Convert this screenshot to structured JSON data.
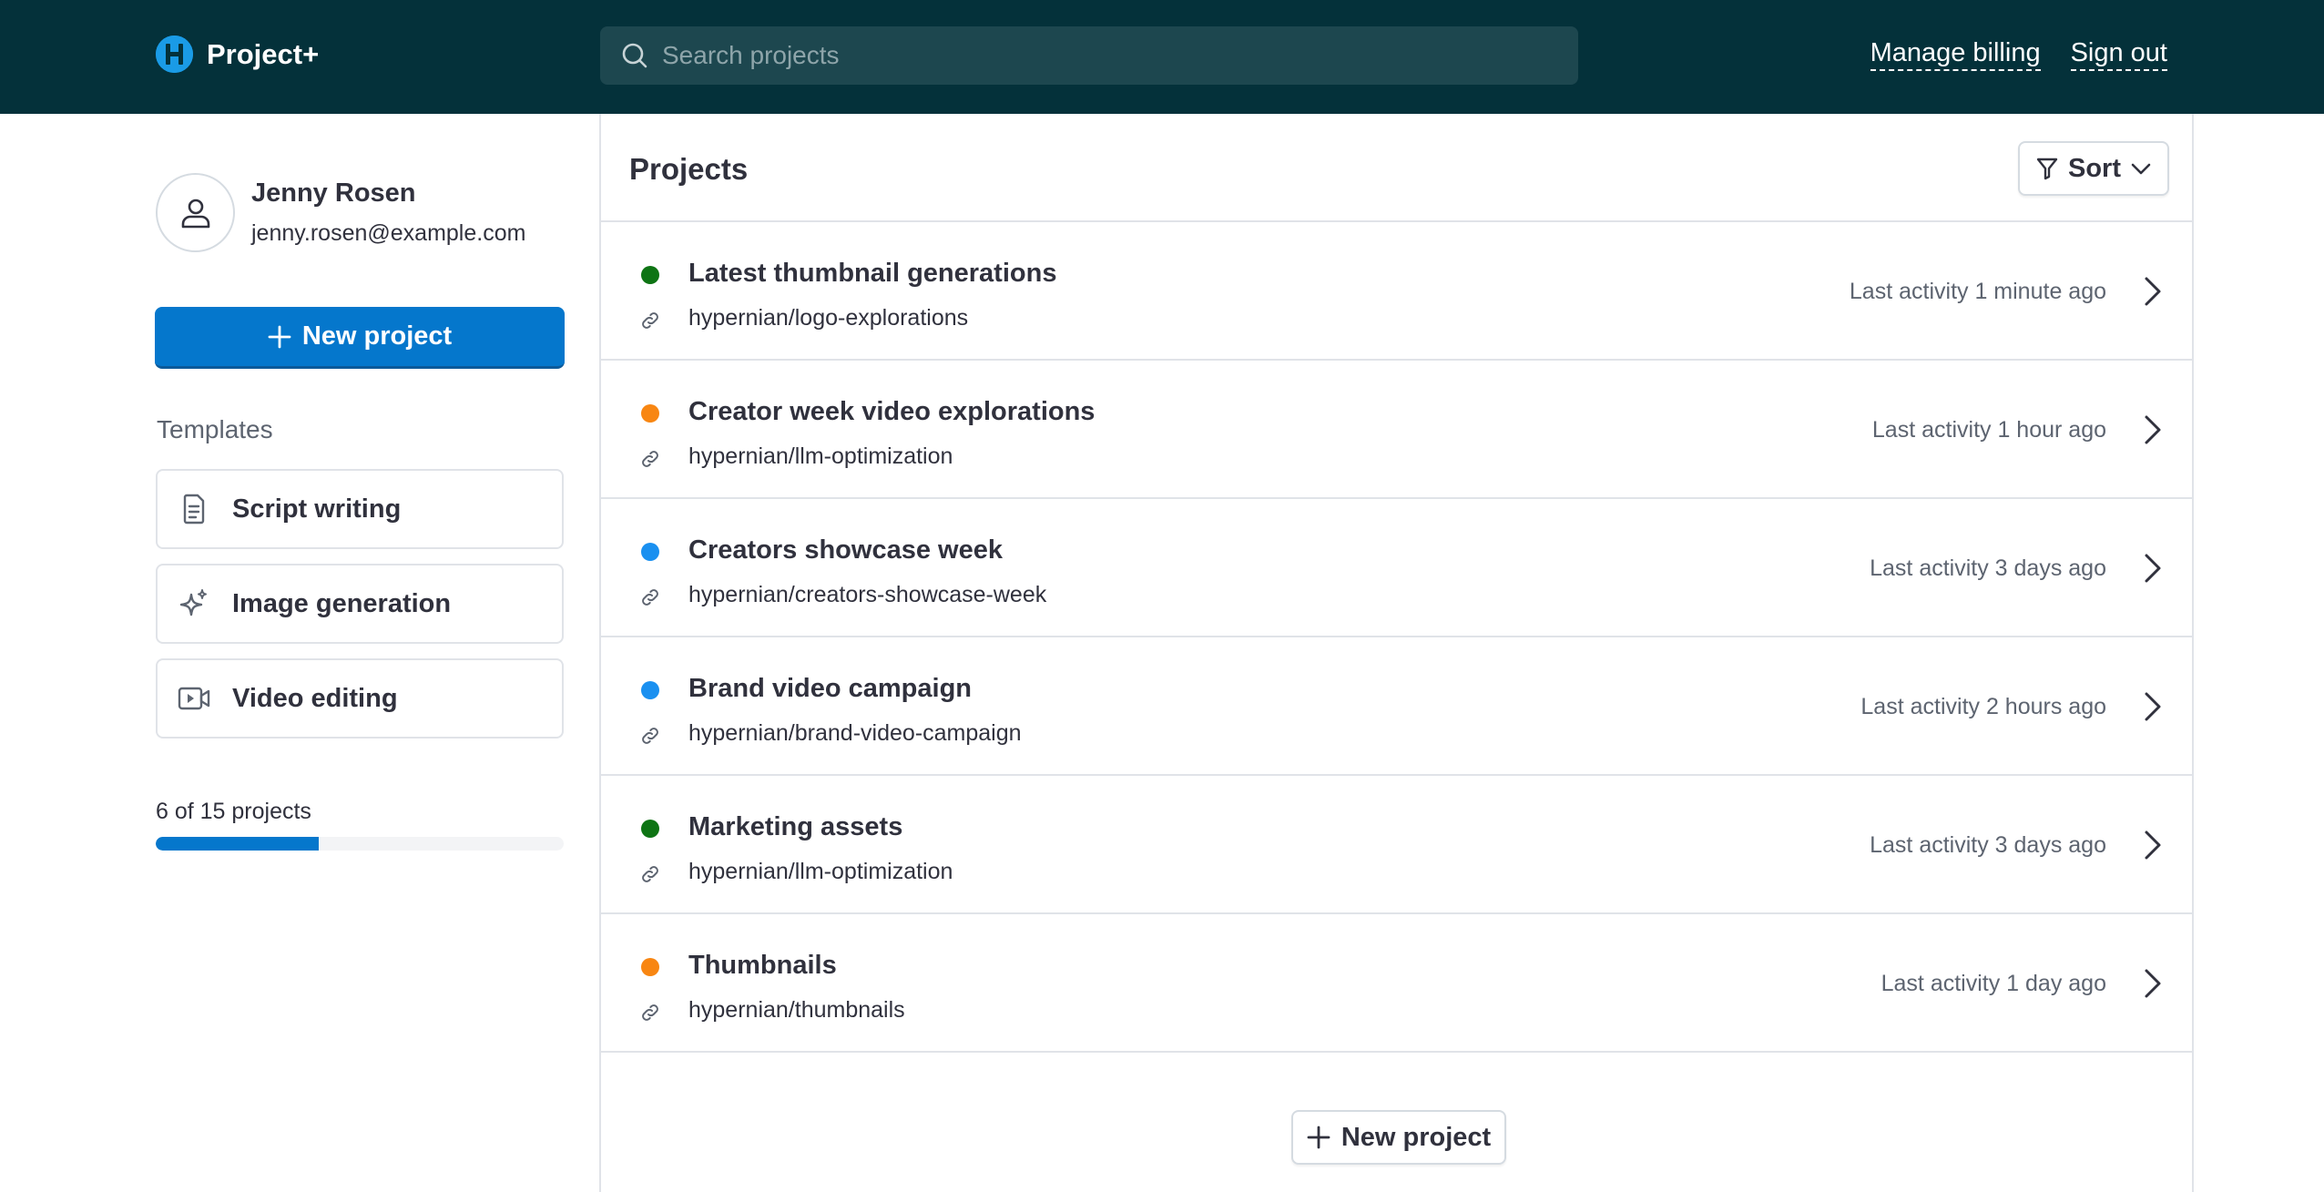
{
  "header": {
    "app_name": "Project+",
    "logo_icon": "hypernian-logo-icon",
    "search_placeholder": "Search projects",
    "search_value": "",
    "links": [
      {
        "label": "Manage billing"
      },
      {
        "label": "Sign out"
      }
    ]
  },
  "user": {
    "name": "Jenny Rosen",
    "email": "jenny.rosen@example.com",
    "avatar_icon": "user-icon"
  },
  "sidebar": {
    "new_project_label": "New project",
    "templates_heading": "Templates",
    "templates": [
      {
        "label": "Script writing",
        "icon": "document-icon"
      },
      {
        "label": "Image generation",
        "icon": "sparkle-icon"
      },
      {
        "label": "Video editing",
        "icon": "video-icon"
      }
    ],
    "usage": {
      "label": "6 of 15 projects",
      "used": 6,
      "total": 15
    }
  },
  "main": {
    "title": "Projects",
    "sort_label": "Sort",
    "projects": [
      {
        "title": "Latest thumbnail generations",
        "repo": "hypernian/logo-explorations",
        "activity": "Last activity 1 minute ago",
        "status_color": "#0e7414"
      },
      {
        "title": "Creator week video explorations",
        "repo": "hypernian/llm-optimization",
        "activity": "Last activity 1 hour ago",
        "status_color": "#f88612"
      },
      {
        "title": "Creators showcase week",
        "repo": "hypernian/creators-showcase-week",
        "activity": "Last activity 3 days ago",
        "status_color": "#1a90f0"
      },
      {
        "title": "Brand video campaign",
        "repo": "hypernian/brand-video-campaign",
        "activity": "Last activity 2 hours ago",
        "status_color": "#1a90f0"
      },
      {
        "title": "Marketing assets",
        "repo": "hypernian/llm-optimization",
        "activity": "Last activity 3 days ago",
        "status_color": "#0e7414"
      },
      {
        "title": "Thumbnails",
        "repo": "hypernian/thumbnails",
        "activity": "Last activity 1 day ago",
        "status_color": "#f88612"
      }
    ],
    "new_project_label": "New project"
  },
  "colors": {
    "header_bg": "#04313a",
    "primary": "#0577cc"
  }
}
